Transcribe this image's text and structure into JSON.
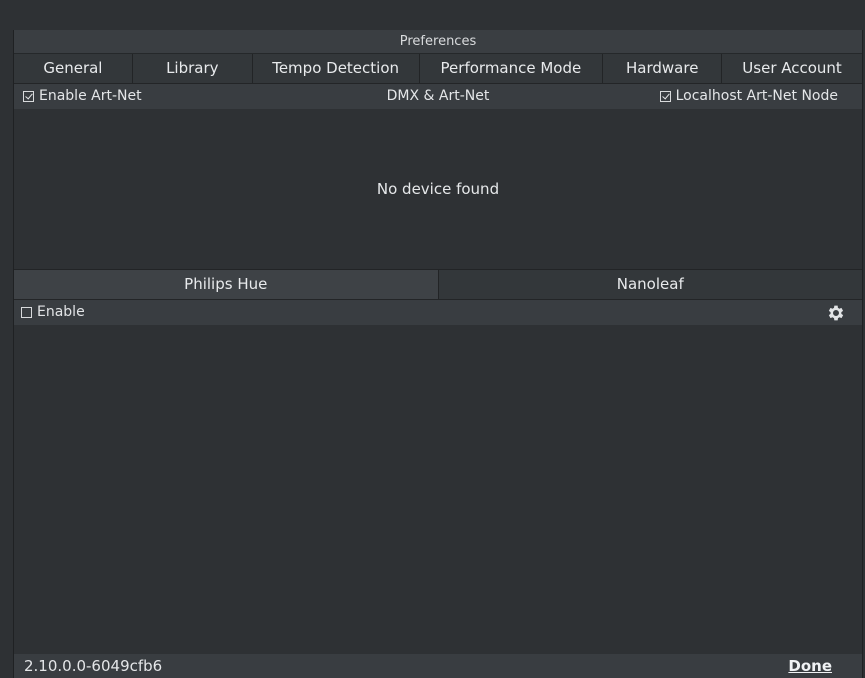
{
  "window": {
    "title": "Preferences"
  },
  "tabs": [
    {
      "label": "General"
    },
    {
      "label": "Library"
    },
    {
      "label": "Tempo Detection"
    },
    {
      "label": "Performance Mode"
    },
    {
      "label": "Hardware"
    },
    {
      "label": "User Account"
    }
  ],
  "dmx": {
    "enable_artnet_label": "Enable Art-Net",
    "enable_artnet_checked": true,
    "section_title": "DMX & Art-Net",
    "localhost_node_label": "Localhost Art-Net Node",
    "localhost_node_checked": true,
    "empty_message": "No device found"
  },
  "lighting_tabs": [
    {
      "label": "Philips Hue",
      "active": true
    },
    {
      "label": "Nanoleaf",
      "active": false
    }
  ],
  "hue": {
    "enable_label": "Enable",
    "enable_checked": false,
    "settings_icon": "gear-icon"
  },
  "footer": {
    "version": "2.10.0.0-6049cfb6",
    "done_label": "Done"
  },
  "colors": {
    "background": "#2e3134",
    "bar": "#393d41",
    "text": "#e4e6e8"
  }
}
